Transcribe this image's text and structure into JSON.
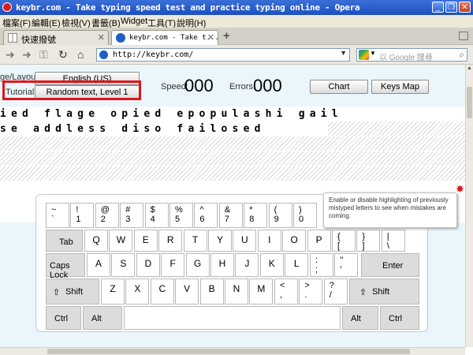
{
  "window": {
    "title": "keybr.com - Take typing speed test and practice typing online - Opera",
    "buttons": [
      "_",
      "❐",
      "✕"
    ]
  },
  "menu": [
    "檔案(F)",
    "編輯(E)",
    "檢視(V)",
    "書籤(B)",
    "Widget",
    "工具(T)",
    "說明(H)"
  ],
  "tabs": [
    {
      "label": "快速撥號",
      "close": "✕",
      "active": false
    },
    {
      "label": "keybr.com - Take t...",
      "close": "✕",
      "active": true
    }
  ],
  "new_tab": "+",
  "address": {
    "url": "http://keybr.com/",
    "search_placeholder": "以 Google 搜尋"
  },
  "page": {
    "layout_label": "ge/Layout:",
    "layout_value": "English (US)",
    "tutorial_label": "Tutorial:",
    "tutorial_value": "Random text, Level 1",
    "speed_label": "Speed:",
    "speed_value": "000",
    "errors_label": "Errors:",
    "errors_value": "000",
    "chart_button": "Chart",
    "keysmap_button": "Keys Map",
    "line1": "ied flage opied epopulashi gail",
    "line2": "se addless diso failosed",
    "tooltip": "Enable or disable highlighting of previously mistyped letters to see when mistakes are coming.",
    "marker": "✸"
  },
  "keyboard": {
    "row1": [
      {
        "top": "~",
        "bottom": "`"
      },
      {
        "top": "!",
        "bottom": "1"
      },
      {
        "top": "@",
        "bottom": "2"
      },
      {
        "top": "#",
        "bottom": "3"
      },
      {
        "top": "$",
        "bottom": "4"
      },
      {
        "top": "%",
        "bottom": "5"
      },
      {
        "top": "^",
        "bottom": "6"
      },
      {
        "top": "&",
        "bottom": "7"
      },
      {
        "top": "*",
        "bottom": "8"
      },
      {
        "top": "(",
        "bottom": "9"
      },
      {
        "top": ")",
        "bottom": "0"
      }
    ],
    "row2": [
      "Tab",
      "Q",
      "W",
      "E",
      "R",
      "T",
      "Y",
      "U",
      "I",
      "O",
      "P",
      "{",
      "[",
      "}",
      "]",
      "|",
      "\\"
    ],
    "row2_letters": [
      "Q",
      "W",
      "E",
      "R",
      "T",
      "Y",
      "U",
      "I",
      "O",
      "P"
    ],
    "row2_brackets": [
      {
        "top": "{",
        "bottom": "["
      },
      {
        "top": "}",
        "bottom": "]"
      },
      {
        "top": "|",
        "bottom": "\\"
      }
    ],
    "row3_letters": [
      "A",
      "S",
      "D",
      "F",
      "G",
      "H",
      "J",
      "K",
      "L"
    ],
    "row3_punct": [
      {
        "top": ":",
        "bottom": ";"
      },
      {
        "top": "\"",
        "bottom": "'"
      }
    ],
    "row4_letters": [
      "Z",
      "X",
      "C",
      "V",
      "B",
      "N",
      "M"
    ],
    "row4_punct": [
      {
        "top": "<",
        "bottom": ","
      },
      {
        "top": ">",
        "bottom": "."
      },
      {
        "top": "?",
        "bottom": "/"
      }
    ],
    "tab": "Tab",
    "caps": "Caps Lock",
    "enter": "Enter",
    "lshift": "Shift",
    "rshift": "Shift",
    "lctrl": "Ctrl",
    "lalt": "Alt",
    "ralt": "Alt",
    "rctrl": "Ctrl",
    "shift_icon": "⇧"
  }
}
